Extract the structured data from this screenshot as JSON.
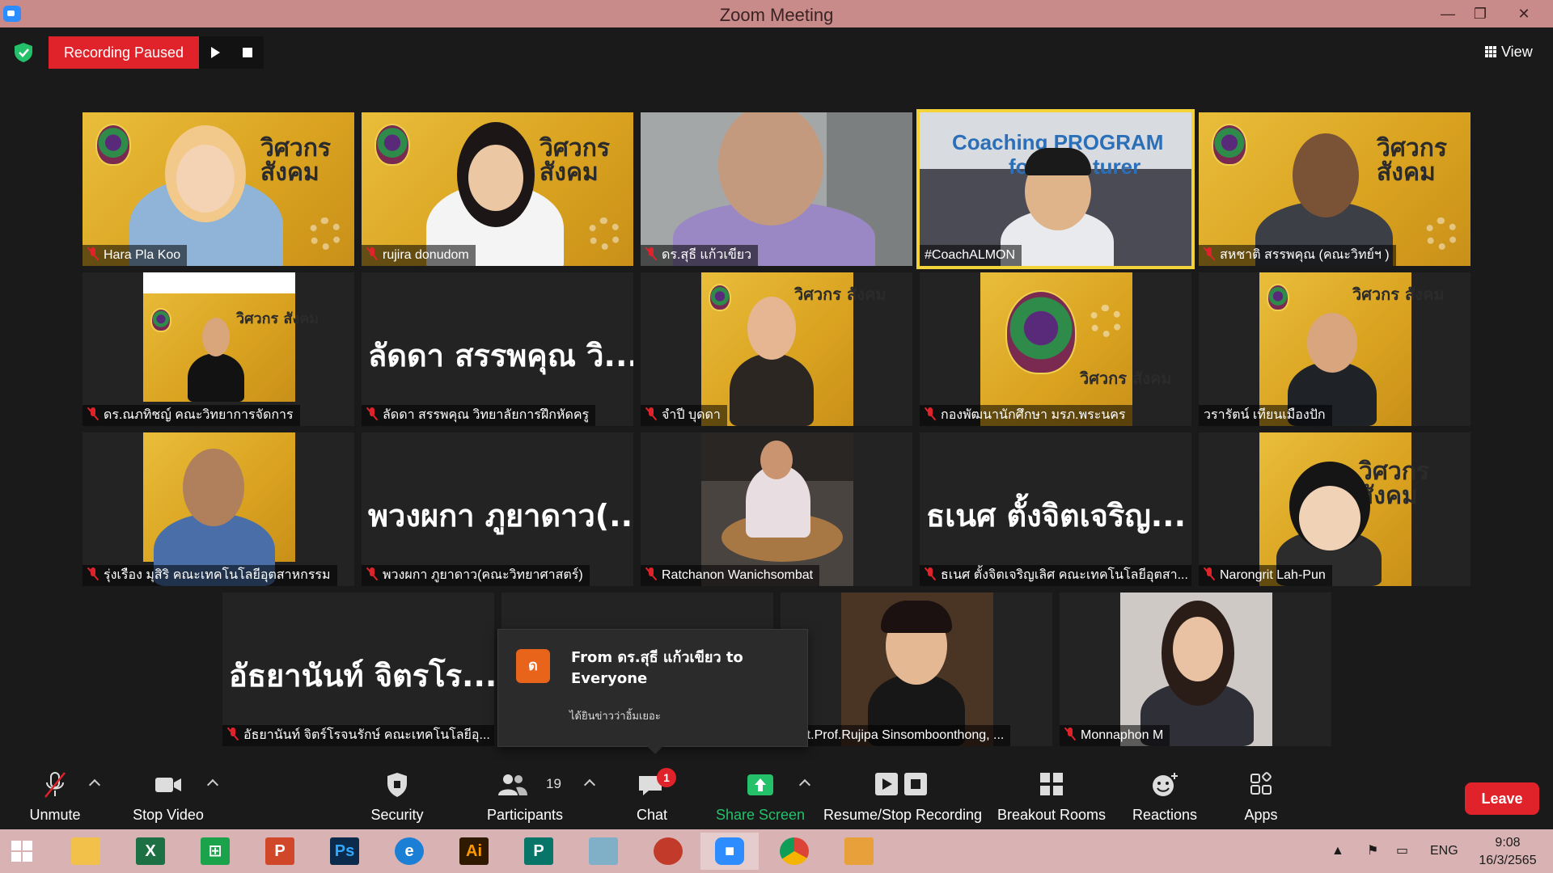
{
  "window": {
    "title": "Zoom Meeting",
    "minimize": "—",
    "restore": "❐",
    "close": "✕"
  },
  "topbar": {
    "recording_status": "Recording Paused",
    "view_label": "View"
  },
  "tiles": [
    {
      "name": "Hara Pla Koo"
    },
    {
      "name": "rujira donudom"
    },
    {
      "name": "ดร.สุธี  แก้วเขียว"
    },
    {
      "name": "#CoachALMON",
      "slide_text_1": "Coaching PROGRAM",
      "slide_text_2": "fo",
      "slide_text_3": "turer"
    },
    {
      "name": "สหชาติ สรรพคุณ (คณะวิทย์ฯ )"
    },
    {
      "name": "ดร.ณภทิชญ์ คณะวิทยาการจัดการ"
    },
    {
      "name": "ลัดดา สรรพคุณ วิทยาลัยการฝึกหัดครู",
      "display": "ลัดดา สรรพคุณ วิ..."
    },
    {
      "name": "จำปี บุดดา"
    },
    {
      "name": "กองพัฒนานักศึกษา มรภ.พระนคร"
    },
    {
      "name": "วรารัตน์ เทียนเมืองปัก"
    },
    {
      "name": "รุ่งเรือง มุสิริ คณะเทคโนโลยีอุตสาหกรรม"
    },
    {
      "name": "พวงผกา ภูยาดาว(คณะวิทยาศาสตร์)",
      "display": "พวงผกา ภูยาดาว(..."
    },
    {
      "name": "Ratchanon Wanichsombat"
    },
    {
      "name": "ธเนศ ตั้งจิตเจริญเลิศ คณะเทคโนโลยีอุตสา...",
      "display": "ธเนศ ตั้งจิตเจริญ..."
    },
    {
      "name": "Narongrit Lah-Pun"
    },
    {
      "name": "อัธยานันท์ จิตร์โรจนรักษ์ คณะเทคโนโลยีอุ...",
      "display": "อัธยานันท์ จิตรโร..."
    },
    {
      "name": "Asst.Prof.Rujipa Sinsomboonthong, ..."
    },
    {
      "name": "Monnaphon M"
    }
  ],
  "brand_text": "วิศวกร สังคม",
  "chat_popup": {
    "avatar_letter": "ด",
    "from": "From ดร.สุธี  แก้วเขียว to Everyone",
    "message": "ได้ยินข่าวว่าอิ้มเยอะ"
  },
  "toolbar": {
    "unmute": "Unmute",
    "stop_video": "Stop Video",
    "security": "Security",
    "participants": "Participants",
    "participants_count": "19",
    "chat": "Chat",
    "chat_badge": "1",
    "share_screen": "Share Screen",
    "resume_stop": "Resume/Stop Recording",
    "breakout": "Breakout Rooms",
    "reactions": "Reactions",
    "apps": "Apps",
    "leave": "Leave"
  },
  "taskbar": {
    "language": "ENG",
    "time": "9:08",
    "date": "16/3/2565",
    "app_labels": {
      "ps": "Ps",
      "ai": "Ai"
    }
  },
  "colors": {
    "accent_red": "#e0232b",
    "share_green": "#25c06a",
    "titlebar": "#c98a8a",
    "taskbar": "#d9b3b3"
  }
}
